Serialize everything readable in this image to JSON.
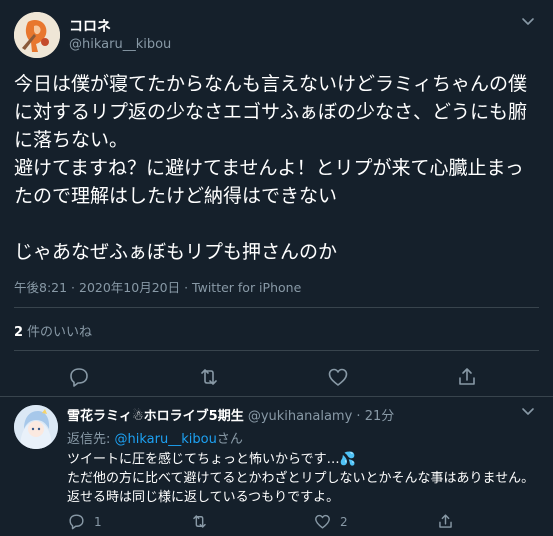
{
  "tweet": {
    "author_name": "コロネ",
    "author_handle": "@hikaru__kibou",
    "text": "今日は僕が寝てたからなんも言えないけどラミィちゃんの僕に対するリプ返の少なさエゴサふぁぼの少なさ、どうにも腑に落ちない。\n避けてますね？に避けてませんよ！とリプが来て心臓止まったので理解はしたけど納得はできない\n\nじゃあなぜふぁぼもリプも押さんのか",
    "meta": "午後8:21 · 2020年10月20日 · Twitter for iPhone",
    "likes_count": "2",
    "likes_label": "件のいいね"
  },
  "reply": {
    "author_name": "雪花ラミィ☃ホロライブ5期生",
    "author_handle": "@yukihanalamy",
    "separator": "·",
    "time": "21分",
    "reply_to_prefix": "返信先: ",
    "reply_to_mention": "@hikaru__kibou",
    "reply_to_suffix": "さん",
    "text": "ツイートに圧を感じてちょっと怖いからです…💦\nただ他の方に比べて避けてるとかわざとリプしないとかそんな事はありません。返せる時は同じ様に返しているつもりですよ。",
    "reply_count": "1",
    "like_count": "2"
  },
  "icons": {
    "more": "chevron-down-icon",
    "reply": "reply-icon",
    "retweet": "retweet-icon",
    "like": "heart-icon",
    "share": "share-icon"
  },
  "colors": {
    "background": "#15202b",
    "text": "#ffffff",
    "secondary": "#8899a6",
    "link": "#1da1f2",
    "border": "#38444d"
  }
}
